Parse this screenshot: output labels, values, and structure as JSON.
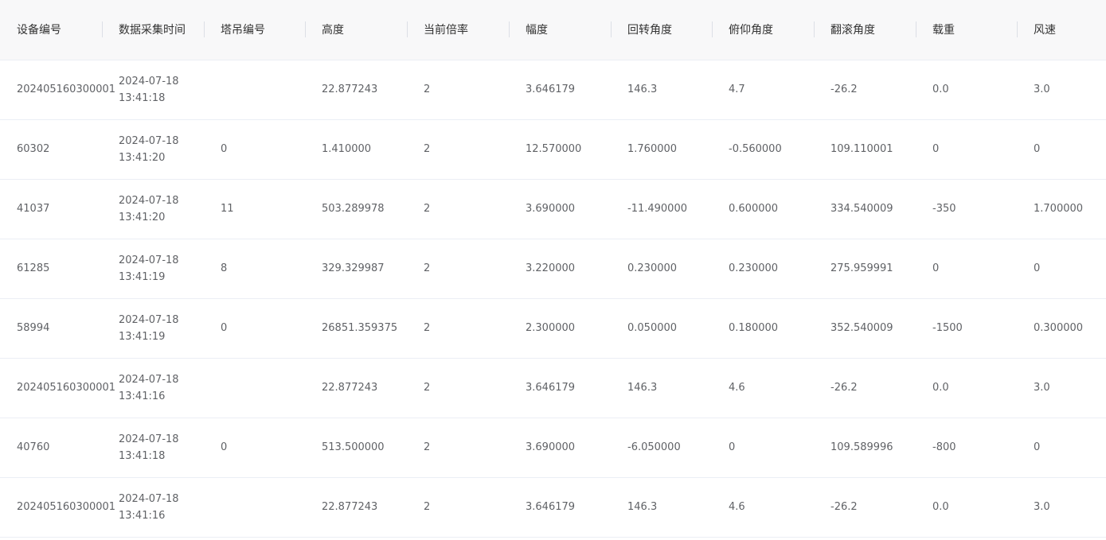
{
  "columns": [
    "设备编号",
    "数据采集时间",
    "塔吊编号",
    "高度",
    "当前倍率",
    "幅度",
    "回转角度",
    "俯仰角度",
    "翻滚角度",
    "载重",
    "风速"
  ],
  "rows": [
    {
      "device": "202405160300001",
      "date": "2024-07-18",
      "time": "13:41:18",
      "crane": "",
      "height": "22.877243",
      "rate": "2",
      "range": "3.646179",
      "rotation": "146.3",
      "pitch": "4.7",
      "roll": "-26.2",
      "load": "0.0",
      "wind": "3.0"
    },
    {
      "device": "60302",
      "date": "2024-07-18",
      "time": "13:41:20",
      "crane": "0",
      "height": "1.410000",
      "rate": "2",
      "range": "12.570000",
      "rotation": "1.760000",
      "pitch": "-0.560000",
      "roll": "109.110001",
      "load": "0",
      "wind": "0"
    },
    {
      "device": "41037",
      "date": "2024-07-18",
      "time": "13:41:20",
      "crane": "11",
      "height": "503.289978",
      "rate": "2",
      "range": "3.690000",
      "rotation": "-11.490000",
      "pitch": "0.600000",
      "roll": "334.540009",
      "load": "-350",
      "wind": "1.700000"
    },
    {
      "device": "61285",
      "date": "2024-07-18",
      "time": "13:41:19",
      "crane": "8",
      "height": "329.329987",
      "rate": "2",
      "range": "3.220000",
      "rotation": "0.230000",
      "pitch": "0.230000",
      "roll": "275.959991",
      "load": "0",
      "wind": "0"
    },
    {
      "device": "58994",
      "date": "2024-07-18",
      "time": "13:41:19",
      "crane": "0",
      "height": "26851.359375",
      "rate": "2",
      "range": "2.300000",
      "rotation": "0.050000",
      "pitch": "0.180000",
      "roll": "352.540009",
      "load": "-1500",
      "wind": "0.300000"
    },
    {
      "device": "202405160300001",
      "date": "2024-07-18",
      "time": "13:41:16",
      "crane": "",
      "height": "22.877243",
      "rate": "2",
      "range": "3.646179",
      "rotation": "146.3",
      "pitch": "4.6",
      "roll": "-26.2",
      "load": "0.0",
      "wind": "3.0"
    },
    {
      "device": "40760",
      "date": "2024-07-18",
      "time": "13:41:18",
      "crane": "0",
      "height": "513.500000",
      "rate": "2",
      "range": "3.690000",
      "rotation": "-6.050000",
      "pitch": "0",
      "roll": "109.589996",
      "load": "-800",
      "wind": "0"
    },
    {
      "device": "202405160300001",
      "date": "2024-07-18",
      "time": "13:41:16",
      "crane": "",
      "height": "22.877243",
      "rate": "2",
      "range": "3.646179",
      "rotation": "146.3",
      "pitch": "4.6",
      "roll": "-26.2",
      "load": "0.0",
      "wind": "3.0"
    }
  ]
}
